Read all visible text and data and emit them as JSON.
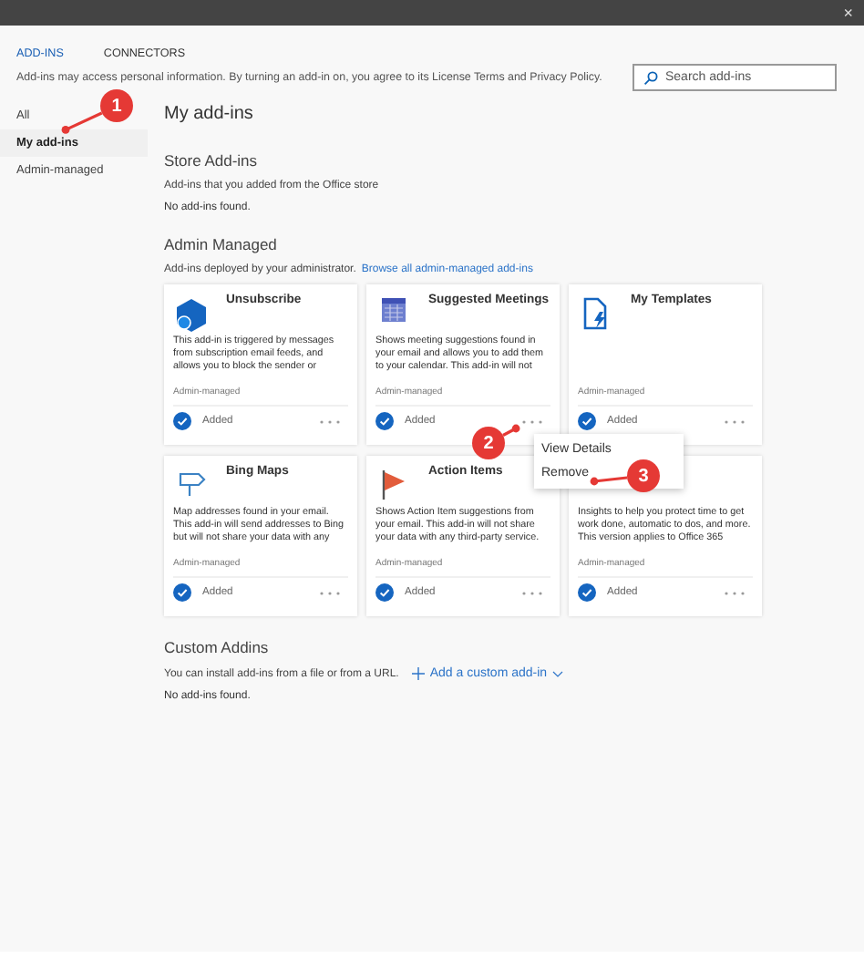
{
  "window": {
    "close": "×"
  },
  "tabs": [
    {
      "label": "ADD-INS",
      "selected": true
    },
    {
      "label": "CONNECTORS",
      "selected": false
    }
  ],
  "notice": "Add-ins may access personal information. By turning an add-in on, you agree to its License Terms and Privacy Policy.",
  "search": {
    "placeholder": "Search add-ins"
  },
  "sidebar": {
    "items": [
      {
        "label": "All",
        "selected": false
      },
      {
        "label": "My add-ins",
        "selected": true
      },
      {
        "label": "Admin-managed",
        "selected": false
      }
    ]
  },
  "page_title": "My add-ins",
  "sections": [
    {
      "title": "Store Add-ins",
      "description": "Add-ins that you added from the Office store",
      "empty": "No add-ins found."
    },
    {
      "title": "Admin Managed",
      "description": "Add-ins deployed by your administrator.",
      "link": "Browse all admin-managed add-ins",
      "cards": [
        {
          "title": "Unsubscribe",
          "description": "This add-in is triggered by messages from subscription email feeds, and allows you to block the sender or",
          "source": "Admin-managed",
          "status": "Added",
          "added": true
        },
        {
          "title": "Suggested Meetings",
          "description": "Shows meeting suggestions found in your email and allows you to add them to your calendar. This add-in will not",
          "source": "Admin-managed",
          "status": "Added",
          "added": true
        },
        {
          "title": "My Templates",
          "source": "Admin-managed",
          "status": "Added",
          "added": true
        },
        {
          "title": "Bing Maps",
          "description": "Map addresses found in your email. This add-in will send addresses to Bing but will not share your data with any",
          "source": "Admin-managed",
          "status": "Added",
          "added": true
        },
        {
          "title": "Action Items",
          "description": "Shows Action Item suggestions from your email. This add-in will not share your data with any third-party service.",
          "source": "Admin-managed",
          "status": "Added",
          "added": true
        },
        {
          "description": "Insights to help you protect time to get work done, automatic to dos, and more. This version applies to Office 365",
          "source": "Admin-managed",
          "status": "Added",
          "added": true
        }
      ]
    },
    {
      "title": "Custom Addins",
      "description": "You can install add-ins from a file or from a URL.",
      "action": "Add a custom add-in",
      "empty": "No add-ins found."
    }
  ],
  "context_menu": {
    "items": [
      "View Details",
      "Remove"
    ]
  },
  "callouts": [
    "1",
    "2",
    "3"
  ]
}
